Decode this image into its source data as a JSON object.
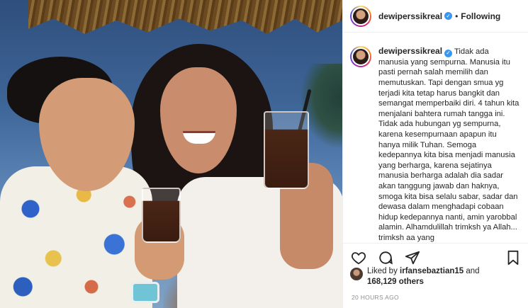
{
  "header": {
    "username": "dewiperssikreal",
    "separator": "•",
    "follow_label": "Following"
  },
  "caption": {
    "username": "dewiperssikreal",
    "text": "Tidak ada manusia yang sempurna. Manusia itu pasti pernah salah memilih dan memutuskan. Tapi dengan smua yg terjadi kita tetap harus bangkit dan semangat memperbaiki diri. 4 tahun kita menjalani bahtera rumah tangga ini. Tidak ada hubungan yg sempurna, karena kesempurnaan apapun itu hanya milik Tuhan. Semoga kedepannya kita bisa menjadi manusia yang berharga, karena sejatinya manusia berharga adalah dia sadar akan tanggung jawab dan haknya, smoga kita bisa selalu sabar, sadar dan dewasa dalam menghadapi cobaan hidup kedepannya nanti, amin yarobbal alamin. Alhamdulillah trimksh ya Allah... trimksh aa yang"
  },
  "likes": {
    "prefix": "Liked by ",
    "user": "irfansebaztian15",
    "conjunction": " and",
    "count": "168,129 others"
  },
  "timestamp": "20 HOURS AGO",
  "icons": {
    "verified": "verified-badge-icon",
    "like": "heart-icon",
    "comment": "comment-icon",
    "share": "paper-plane-icon",
    "save": "bookmark-icon"
  },
  "colors": {
    "verified_blue": "#3897f0",
    "text": "#262626",
    "muted": "#8e8e8e",
    "border": "#efefef"
  }
}
